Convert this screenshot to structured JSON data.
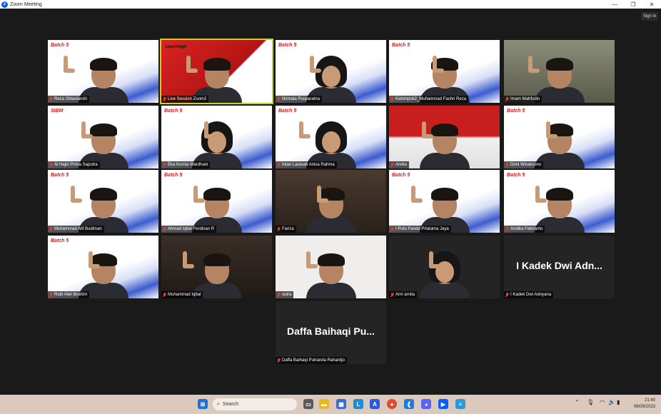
{
  "window": {
    "title": "Zoom Meeting",
    "controls": [
      "—",
      "❐",
      "✕"
    ]
  },
  "sign_in_label": "Sign in",
  "tiles": [
    {
      "name": "Reza Oktaviandri",
      "bg": "batch",
      "label": "Batch 5"
    },
    {
      "name": "Live Session Zoom2",
      "bg": "red",
      "label": "LearningX",
      "active": true
    },
    {
      "name": "Nirmala Pusparatna",
      "bg": "batch",
      "label": "Batch 5",
      "hijab": true
    },
    {
      "name": "Kelompok2_Muhammad Fachri Reza",
      "bg": "batch",
      "label": "Batch 5"
    },
    {
      "name": "Imam Mahfudin",
      "bg": "room",
      "label": ""
    },
    {
      "name": "Al Hajiri Prima Saputra",
      "bg": "batch",
      "label": "SIBM"
    },
    {
      "name": "Eka Kurnia Wardhani",
      "bg": "batch",
      "label": "Batch 5",
      "hijab": true
    },
    {
      "name": "Intan Larasati Anisa Rahma",
      "bg": "batch",
      "label": "Batch 5",
      "hijab": true
    },
    {
      "name": "Andre",
      "bg": "flag",
      "label": ""
    },
    {
      "name": "Doni Wicaksono",
      "bg": "batch",
      "label": "Batch 5"
    },
    {
      "name": "Muhammad Alif Budiman",
      "bg": "batch",
      "label": "Batch 5"
    },
    {
      "name": "Ahmad Iqbal Ferdinan R",
      "bg": "batch",
      "label": "Batch 5"
    },
    {
      "name": "Fariza",
      "bg": "dark",
      "label": ""
    },
    {
      "name": "I Putu Pande Prlatama Jaya",
      "bg": "batch",
      "label": "Batch 5"
    },
    {
      "name": "Andika Febrianto",
      "bg": "batch",
      "label": "Batch 5"
    },
    {
      "name": "Robi Alwi Ibrahim",
      "bg": "batch",
      "label": "Batch 5"
    },
    {
      "name": "Muhammad Iqbal",
      "bg": "dark2",
      "label": ""
    },
    {
      "name": "sutra",
      "bg": "white",
      "label": ""
    },
    {
      "name": "Arni arnila",
      "bg": "black",
      "label": "",
      "hijab": true
    },
    {
      "name": "I Kadek Dwi Adnyana",
      "bg": "black",
      "label": "",
      "big": "I Kadek Dwi Adn..."
    },
    {
      "name": "Daffa Baihaqi Putranda Rahardjo",
      "bg": "black",
      "label": "",
      "big": "Daffa Baihaqi Pu..."
    }
  ],
  "taskbar": {
    "search_placeholder": "Search",
    "clock_time": "21:40",
    "clock_date": "06/09/2023"
  },
  "colors": {
    "accent_active": "#c3d02f",
    "muted_mic": "#e03a3a",
    "zoom_blue": "#0b5cff"
  }
}
